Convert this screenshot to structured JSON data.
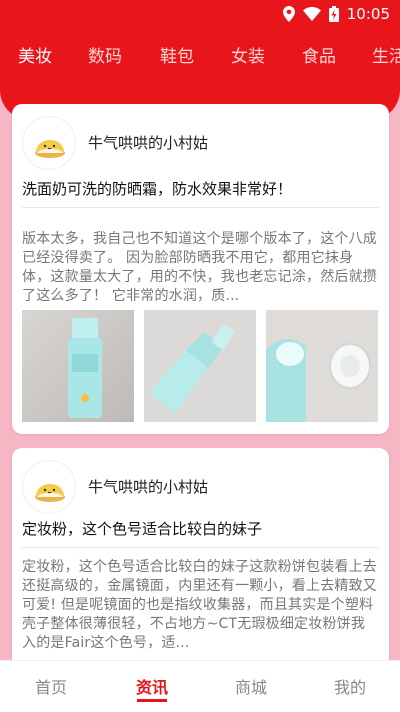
{
  "status": {
    "time": "10:05"
  },
  "categories": [
    {
      "label": "美妆",
      "active": true
    },
    {
      "label": "数码",
      "active": false
    },
    {
      "label": "鞋包",
      "active": false
    },
    {
      "label": "女装",
      "active": false
    },
    {
      "label": "食品",
      "active": false
    },
    {
      "label": "生活",
      "active": false
    }
  ],
  "feed": [
    {
      "author": "牛气哄哄的小村姑",
      "title": "洗面奶可洗的防晒霜，防水效果非常好！",
      "excerpt": "版本太多，我自己也不知道这个是哪个版本了，这个八成已经没得卖了。 因为脸部防晒我不用它，都用它抹身体，这款量太大了，用的不快，我也老忘记涂，然后就攒了这么多了！ 它非常的水润，质...",
      "thumbnails": [
        "sunscreen-bottle-photo",
        "sunscreen-tube-photo",
        "sunscreen-cap-photo"
      ]
    },
    {
      "author": "牛气哄哄的小村姑",
      "title": "定妆粉，这个色号适合比较白的妹子",
      "excerpt": "定妆粉，这个色号适合比较白的妹子这款粉饼包装看上去还挺高级的，金属镜面，内里还有一颗小，看上去精致又可爱! 但是呢镜面的也是指纹收集器，而且其实是个塑料壳子整体很薄很轻，不占地方~CT无瑕极细定妆粉饼我入的是Fair这个色号，适..."
    }
  ],
  "tabbar": [
    {
      "label": "首页",
      "active": false
    },
    {
      "label": "资讯",
      "active": true
    },
    {
      "label": "商城",
      "active": false
    },
    {
      "label": "我的",
      "active": false
    }
  ],
  "colors": {
    "brand_red": "#e8161b",
    "background_pink": "#f7b6c4"
  }
}
